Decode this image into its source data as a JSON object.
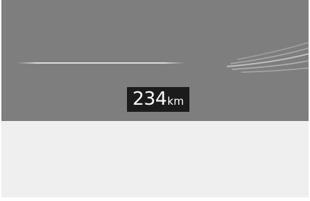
{
  "distance": {
    "value": "234",
    "unit": "km"
  },
  "colors": {
    "display_background": "#7e7e7e",
    "lower_panel": "#efefef",
    "badge_background": "#1b1b1b",
    "badge_text": "#ffffff",
    "lane_lines": "#e6e6e6"
  }
}
